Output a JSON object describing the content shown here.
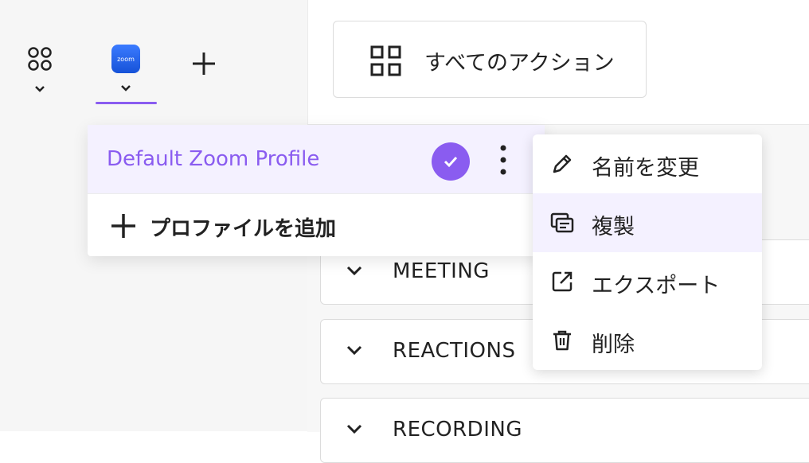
{
  "sidebar": {
    "zoom_logo_text": "zoom"
  },
  "toolbar": {
    "all_actions_label": "すべてのアクション"
  },
  "sections": [
    {
      "title": "MEETING"
    },
    {
      "title": "REACTIONS"
    },
    {
      "title": "RECORDING"
    }
  ],
  "profile_menu": {
    "active_profile": "Default Zoom Profile",
    "add_profile_label": "プロファイルを追加"
  },
  "context_menu": {
    "items": [
      {
        "label": "名前を変更",
        "icon": "pencil-icon"
      },
      {
        "label": "複製",
        "icon": "duplicate-icon"
      },
      {
        "label": "エクスポート",
        "icon": "export-icon"
      },
      {
        "label": "削除",
        "icon": "trash-icon"
      }
    ]
  },
  "colors": {
    "accent": "#8a5cf0",
    "accent_bg": "#f4f1ff",
    "zoom_blue": "#1652d8"
  }
}
